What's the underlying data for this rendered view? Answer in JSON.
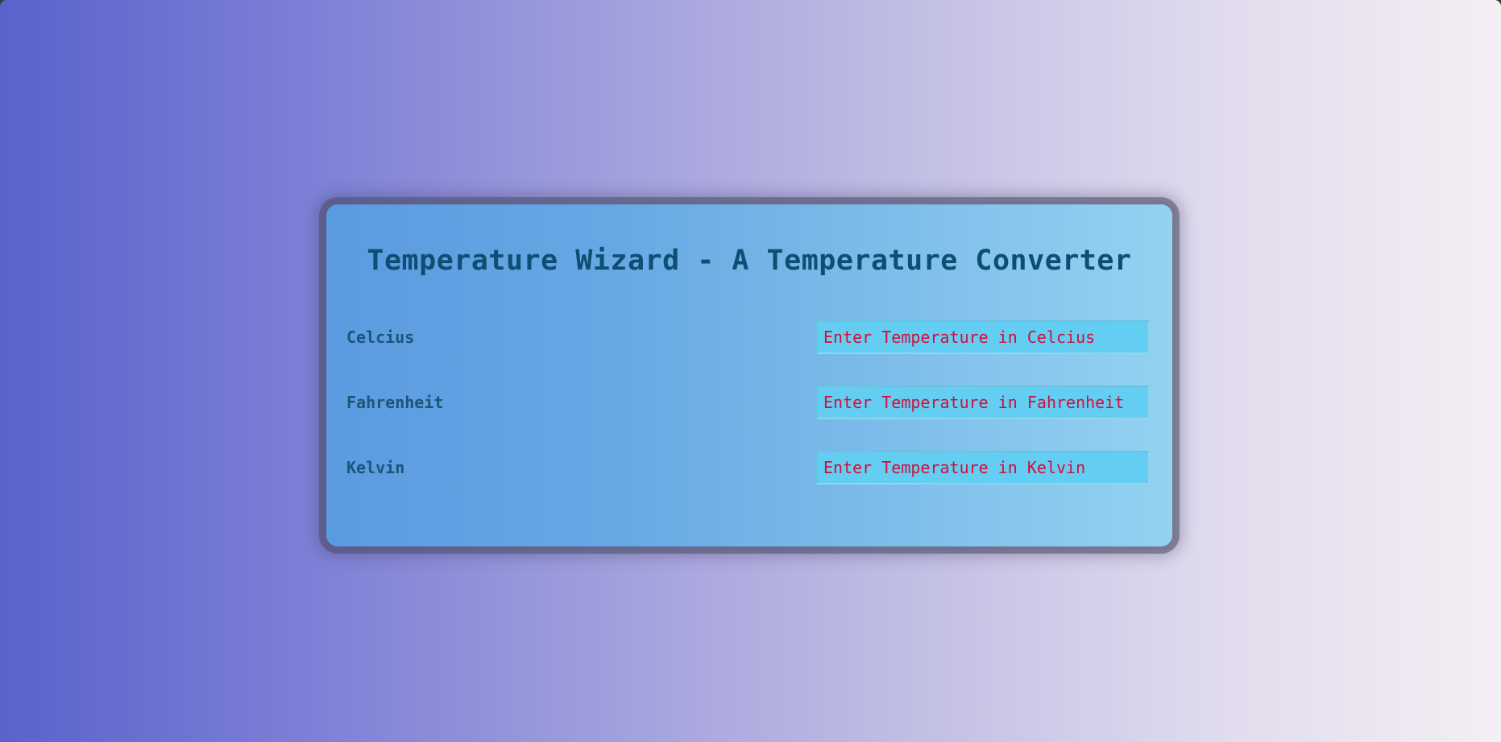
{
  "app": {
    "title": "Temperature Wizard - A Temperature Converter"
  },
  "fields": [
    {
      "label": "Celcius",
      "placeholder": "Enter Temperature in Celcius",
      "value": ""
    },
    {
      "label": "Fahrenheit",
      "placeholder": "Enter Temperature in Fahrenheit",
      "value": ""
    },
    {
      "label": "Kelvin",
      "placeholder": "Enter Temperature in Kelvin",
      "value": ""
    }
  ],
  "colors": {
    "title": "#0d4f72",
    "label": "#1b5578",
    "placeholder": "#d0103a",
    "input_background": "#63cdf2",
    "card_gradient_start": "#5a9ae0",
    "card_gradient_end": "#94d2f0",
    "page_gradient_start": "#5a62cc",
    "page_gradient_end": "#f3eff4"
  }
}
